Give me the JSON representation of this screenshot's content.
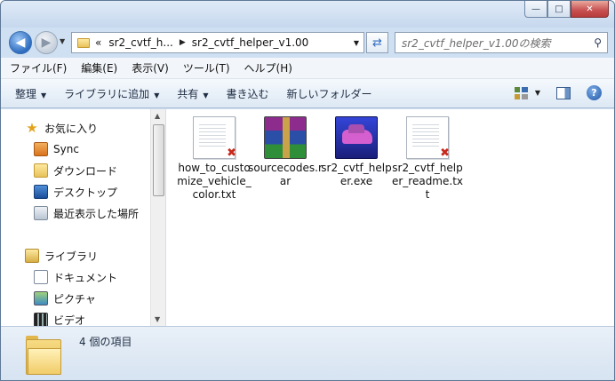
{
  "window": {
    "buttons": {
      "minimize": "—",
      "maximize": "□",
      "close": "✕"
    }
  },
  "address": {
    "overflow": "«",
    "crumbs": [
      "sr2_cvtf_h...",
      "sr2_cvtf_helper_v1.00"
    ]
  },
  "search": {
    "placeholder": "sr2_cvtf_helper_v1.00の検索",
    "icon": "search-icon"
  },
  "menu": [
    "ファイル(F)",
    "編集(E)",
    "表示(V)",
    "ツール(T)",
    "ヘルプ(H)"
  ],
  "toolbar": {
    "organize": "整理",
    "add_library": "ライブラリに追加",
    "share": "共有",
    "burn": "書き込む",
    "new_folder": "新しいフォルダー"
  },
  "nav": {
    "favorites": "お気に入り",
    "sync": "Sync",
    "downloads": "ダウンロード",
    "desktop": "デスクトップ",
    "recent": "最近表示した場所",
    "libraries": "ライブラリ",
    "documents": "ドキュメント",
    "pictures": "ピクチャ",
    "videos": "ビデオ"
  },
  "files": [
    {
      "name": "how_to_customize_vehicle_color.txt",
      "type": "txt"
    },
    {
      "name": "sourcecodes.rar",
      "type": "rar"
    },
    {
      "name": "sr2_cvtf_helper.exe",
      "type": "exe"
    },
    {
      "name": "sr2_cvtf_helper_readme.txt",
      "type": "txt"
    }
  ],
  "status": {
    "count_text": "4 個の項目"
  }
}
